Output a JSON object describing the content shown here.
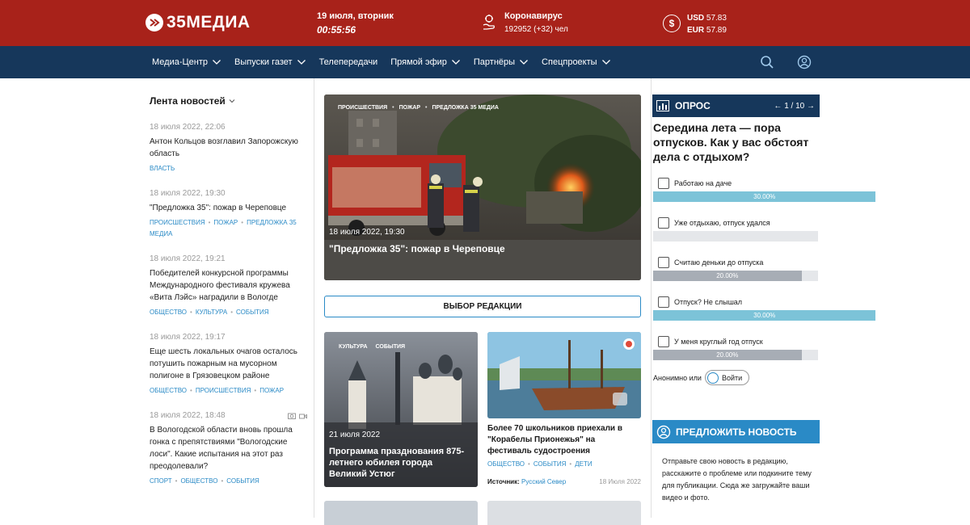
{
  "header": {
    "logo_text": "35МЕДИА",
    "date_line": "19 июля, вторник",
    "time": "00:55:56",
    "covid_title": "Коронавирус",
    "covid_stats": "192952 (+32) чел",
    "usd_label": "USD",
    "usd_value": "57.83",
    "eur_label": "EUR",
    "eur_value": "57.89"
  },
  "nav": {
    "items": [
      {
        "label": "Медиа-Центр",
        "has_dropdown": true
      },
      {
        "label": "Выпуски газет",
        "has_dropdown": true
      },
      {
        "label": "Телепередачи",
        "has_dropdown": false
      },
      {
        "label": "Прямой эфир",
        "has_dropdown": true
      },
      {
        "label": "Партнёры",
        "has_dropdown": true
      },
      {
        "label": "Спецпроекты",
        "has_dropdown": true
      }
    ],
    "search_icon": "search-icon",
    "user_icon": "user-icon"
  },
  "feed": {
    "title": "Лента новостей",
    "items": [
      {
        "time": "18 июля 2022, 22:06",
        "title": "Антон Кольцов возглавил Запорожскую область",
        "tags": [
          "Власть"
        ]
      },
      {
        "time": "18 июля 2022, 19:30",
        "title": "\"Предложка 35\": пожар в Череповце",
        "tags": [
          "Происшествия",
          "Пожар",
          "Предложка 35 Медиа"
        ]
      },
      {
        "time": "18 июля 2022, 19:21",
        "title": "Победителей конкурсной программы Международного фестиваля кружева «Вита Лэйс» наградили в Вологде",
        "tags": [
          "Общество",
          "Культура",
          "События"
        ]
      },
      {
        "time": "18 июля 2022, 19:17",
        "title": "Еще шесть локальных очагов осталось потушить пожарным на мусорном полигоне в Грязовецком районе",
        "tags": [
          "Общество",
          "Происшествия",
          "Пожар"
        ]
      },
      {
        "time": "18 июля 2022, 18:48",
        "title": "В Вологодской области вновь прошла гонка с препятствиями \"Вологодские лоси\". Какие испытания на этот раз преодолевали?",
        "tags": [
          "Спорт",
          "Общество",
          "События"
        ],
        "media_icons": true
      }
    ]
  },
  "hero": {
    "tags": [
      "Происшествия",
      "Пожар",
      "Предложка 35 Медиа"
    ],
    "date": "18 июля 2022, 19:30",
    "title": "\"Предложка 35\": пожар в Череповце"
  },
  "editor_choice_label": "ВЫБОР РЕДАКЦИИ",
  "card1": {
    "tags": [
      "Культура",
      "События"
    ],
    "date": "21 июля 2022",
    "title": "Программа празднования 875-летнего юбилея города Великий Устюг"
  },
  "card2": {
    "title": "Более 70 школьников приехали в \"Корабелы Прионежья\" на фестиваль судостроения",
    "tags": [
      "Общество",
      "События",
      "Дети"
    ],
    "source_label": "Источник:",
    "source_link": "Русский Север",
    "date": "18 Июля 2022"
  },
  "poll": {
    "label": "ОПРОС",
    "pager": "← 1 / 10 →",
    "question": "Середина лета — пора отпусков. Как у вас обстоят дела с отдыхом?",
    "options": [
      {
        "label": "Работаю на даче",
        "percent": 30,
        "percent_text": "30.00%",
        "color": "#7cc3d8"
      },
      {
        "label": "Уже отдыхаю, отпуск удался",
        "percent": 0,
        "percent_text": "",
        "color": "#7cc3d8"
      },
      {
        "label": "Считаю деньки до отпуска",
        "percent": 20,
        "percent_text": "20.00%",
        "color": "#a7adb5"
      },
      {
        "label": "Отпуск? Не слышал",
        "percent": 30,
        "percent_text": "30.00%",
        "color": "#7cc3d8"
      },
      {
        "label": "У меня круглый год отпуск",
        "percent": 20,
        "percent_text": "20.00%",
        "color": "#a7adb5"
      }
    ],
    "anon_text": "Анонимно или",
    "login_label": "Войти"
  },
  "suggest": {
    "label": "ПРЕДЛОЖИТЬ НОВОСТЬ",
    "text": "Отправьте свою новость в редакцию, расскажите о проблеме или подкините тему для публикации. Сюда же загружайте ваши видео и фото."
  },
  "colors": {
    "top_red": "#a8221a",
    "nav_blue": "#16375b",
    "accent_blue": "#2a8ac6"
  }
}
